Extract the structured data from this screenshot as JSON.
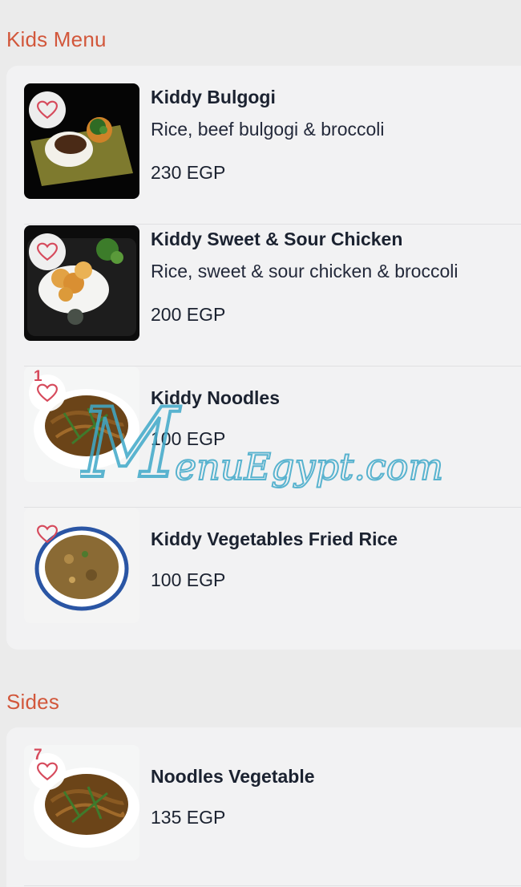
{
  "sections": [
    {
      "title": "Kids Menu",
      "items": [
        {
          "name": "Kiddy Bulgogi",
          "description": "Rice, beef bulgogi & broccoli",
          "price": "230 EGP",
          "fav_count": ""
        },
        {
          "name": "Kiddy Sweet & Sour Chicken",
          "description": "Rice, sweet & sour chicken & broccoli",
          "price": "200 EGP",
          "fav_count": ""
        },
        {
          "name": "Kiddy Noodles",
          "description": "",
          "price": "100 EGP",
          "fav_count": "1"
        },
        {
          "name": "Kiddy Vegetables Fried Rice",
          "description": "",
          "price": "100 EGP",
          "fav_count": ""
        }
      ]
    },
    {
      "title": "Sides",
      "items": [
        {
          "name": "Noodles Vegetable",
          "description": "",
          "price": "135 EGP",
          "fav_count": "7"
        }
      ]
    }
  ],
  "watermark": "MenuEgypt.com",
  "colors": {
    "accent": "#d2573b",
    "heart": "#d64a5c",
    "card_bg": "#f2f2f3",
    "page_bg": "#ebebeb",
    "watermark": "#3fa9c9"
  },
  "icons": {
    "favorite": "heart-outline-icon"
  }
}
